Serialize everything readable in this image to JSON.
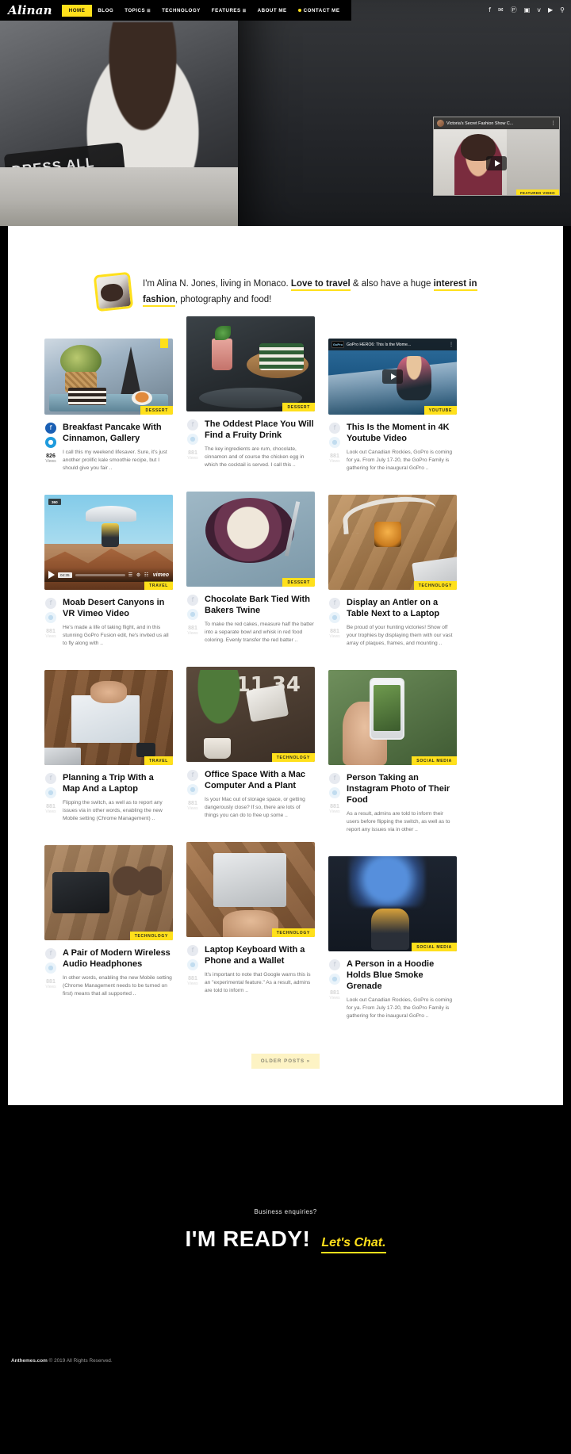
{
  "site": {
    "logo": "Alinan"
  },
  "nav": {
    "items": [
      {
        "label": "HOME",
        "active": true,
        "caret": false,
        "dot": false
      },
      {
        "label": "BLOG",
        "active": false,
        "caret": false,
        "dot": false
      },
      {
        "label": "TOPICS",
        "active": false,
        "caret": true,
        "dot": false
      },
      {
        "label": "TECHNOLOGY",
        "active": false,
        "caret": false,
        "dot": false
      },
      {
        "label": "FEATURES",
        "active": false,
        "caret": true,
        "dot": false
      },
      {
        "label": "ABOUT ME",
        "active": false,
        "caret": false,
        "dot": false
      },
      {
        "label": "CONTACT ME",
        "active": false,
        "caret": false,
        "dot": true
      }
    ],
    "social": [
      {
        "name": "facebook-icon",
        "glyph": "f"
      },
      {
        "name": "twitter-icon",
        "glyph": "✉"
      },
      {
        "name": "pinterest-icon",
        "glyph": "Ⓟ"
      },
      {
        "name": "instagram-icon",
        "glyph": "▣"
      },
      {
        "name": "vimeo-icon",
        "glyph": "v"
      },
      {
        "name": "youtube-icon",
        "glyph": "▶"
      },
      {
        "name": "search-icon",
        "glyph": "⚲"
      }
    ]
  },
  "hero": {
    "pillow_text": "DRESS ALL ME",
    "featured_video": {
      "title": "Victoria's Secret Fashion Show C...",
      "badge": "FEATURED VIDEO",
      "kebab": "⋮"
    }
  },
  "intro": {
    "part1": "I'm Alina N. Jones, living in Monaco. ",
    "highlight1": "Love to travel",
    "part2": " & also have a huge ",
    "highlight2": "interest in fashion",
    "part3": ", photography and food!"
  },
  "labels": {
    "views": "Views",
    "older_posts": "OLDER POSTS »"
  },
  "posts": [
    {
      "id": "breakfast-pancake",
      "title": "Breakfast Pancake With Cinnamon, Gallery",
      "excerpt": "I call this my weekend lifesaver. Sure, it's just another prolific kale smoothie recipe, but I should give you fair ..",
      "category": "DESSERT",
      "views": "826",
      "media": "m-pancake",
      "active_share": true,
      "corner_tab": true,
      "type": "image"
    },
    {
      "id": "oddest-place-fruity-drink",
      "title": "The Oddest Place You Will Find a Fruity Drink",
      "excerpt": "The key ingredients are rum, chocolate, cinnamon and of course the chicken egg in which the cocktail is served. I call this ..",
      "category": "DESSERT",
      "views": "",
      "media": "m-drink",
      "active_share": false,
      "corner_tab": false,
      "type": "image"
    },
    {
      "id": "moment-in-4k-youtube",
      "title": "This Is the Moment in 4K Youtube Video",
      "excerpt": "Look out Canadian Rockies, GoPro is coming for ya. From July 17-20, the GoPro Family is gathering for the inaugural GoPro ..",
      "category": "YOUTUBE",
      "views": "",
      "media": "m-gopro",
      "active_share": false,
      "corner_tab": false,
      "type": "video",
      "video": {
        "title": "GoPro HERO6: This Is the Mome...",
        "brand": "GoPro",
        "kebab": "⋮"
      }
    },
    {
      "id": "moab-desert-canyons-vr",
      "title": "Moab Desert Canyons in VR Vimeo Video",
      "excerpt": "He's made a life of taking flight, and in this stunning GoPro Fusion edit, he's invited us all to fly along with ..",
      "category": "TRAVEL",
      "views": "",
      "media": "m-vimeo",
      "active_share": false,
      "corner_tab": false,
      "type": "vimeo",
      "video": {
        "badge_360": "360",
        "duration": "04:35",
        "brand": "vimeo"
      }
    },
    {
      "id": "chocolate-bark-bakers-twine",
      "title": "Chocolate Bark Tied With Bakers Twine",
      "excerpt": "To make the red cakes, measure half the batter into a separate bowl and whisk in red food coloring. Evenly transfer the red batter ..",
      "category": "DESSERT",
      "views": "",
      "media": "m-choco",
      "active_share": false,
      "corner_tab": false,
      "type": "image"
    },
    {
      "id": "display-antler-table",
      "title": "Display an Antler on a Table Next to a Laptop",
      "excerpt": "Be proud of your hunting victories! Show off your trophies by displaying them with our vast array of plaques, frames, and mounting ..",
      "category": "TECHNOLOGY",
      "views": "",
      "media": "m-antler",
      "active_share": false,
      "corner_tab": false,
      "type": "image"
    },
    {
      "id": "planning-trip-map-laptop",
      "title": "Planning a Trip With a Map And a Laptop",
      "excerpt": "Flipping the switch, as well as to report any issues via in other words, enabling the new Mobile setting (Chrome Management) ..",
      "category": "TRAVEL",
      "views": "",
      "media": "m-map",
      "active_share": false,
      "corner_tab": false,
      "type": "image"
    },
    {
      "id": "office-space-mac-plant",
      "title": "Office Space With a Mac Computer And a Plant",
      "excerpt": "Is your Mac out of storage space, or getting dangerously close? If so, there are lots of things you can do to free up some ..",
      "category": "TECHNOLOGY",
      "views": "",
      "media": "m-office",
      "active_share": false,
      "corner_tab": false,
      "type": "image"
    },
    {
      "id": "person-instagram-photo-food",
      "title": "Person Taking an Instagram Photo of Their Food",
      "excerpt": "As a result, admins are told to inform their users before flipping the switch, as well as to report any issues via in other ..",
      "category": "SOCIAL MEDIA",
      "views": "",
      "media": "m-insta",
      "active_share": false,
      "corner_tab": false,
      "type": "image"
    },
    {
      "id": "pair-modern-wireless-headphones",
      "title": "A Pair of Modern Wireless Audio Headphones",
      "excerpt": "In other words, enabling the new Mobile setting (Chrome Management needs to be turned on first) means that all supported ..",
      "category": "TECHNOLOGY",
      "views": "",
      "media": "m-head",
      "active_share": false,
      "corner_tab": false,
      "type": "image"
    },
    {
      "id": "laptop-keyboard-phone-wallet",
      "title": "Laptop Keyboard With a Phone and a Wallet",
      "excerpt": "It's important to note that Google warns this is an \"experimental feature.\" As a result, admins are told to inform ..",
      "category": "TECHNOLOGY",
      "views": "",
      "media": "m-keyb",
      "active_share": false,
      "corner_tab": false,
      "type": "image"
    },
    {
      "id": "person-hoodie-blue-smoke",
      "title": "A Person in a Hoodie Holds Blue Smoke Grenade",
      "excerpt": "Look out Canadian Rockies, GoPro is coming for ya. From July 17-20, the GoPro Family is gathering for the inaugural GoPro ..",
      "category": "SOCIAL MEDIA",
      "views": "",
      "media": "m-smoke",
      "active_share": false,
      "corner_tab": false,
      "type": "image"
    }
  ],
  "footer": {
    "eyebrow": "Business enquiries?",
    "ready": "I'M READY!",
    "chat": "Let's Chat.",
    "copyright_brand": "Anthemes.com",
    "copyright_rest": " © 2019 All Rights Reserved."
  },
  "colors": {
    "accent": "#ffe01b",
    "dark": "#000000",
    "facebook": "#1a5fb4",
    "twitter": "#1f9bdd"
  }
}
